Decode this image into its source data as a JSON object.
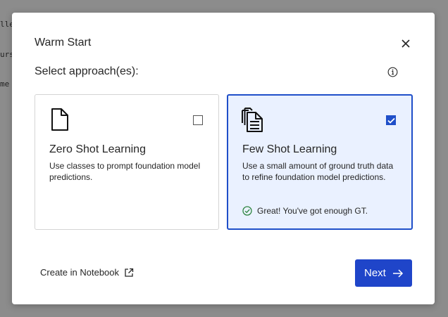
{
  "background": {
    "fragments": [
      "lle",
      "urs",
      " me"
    ]
  },
  "modal": {
    "title": "Warm Start",
    "subtitle": "Select approach(es):",
    "close_icon": "close-icon",
    "info_icon": "info-icon"
  },
  "cards": [
    {
      "title": "Zero Shot Learning",
      "description": "Use classes to prompt foundation model predictions.",
      "icon": "document-icon",
      "checked": false
    },
    {
      "title": "Few Shot Learning",
      "description": "Use a small amount of ground truth data to refine foundation model predictions.",
      "icon": "documents-stack-icon",
      "checked": true,
      "status": "Great! You've got enough GT.",
      "status_icon": "check-circle-icon"
    }
  ],
  "footer": {
    "notebook_link": "Create in Notebook",
    "notebook_icon": "external-link-icon",
    "next_label": "Next",
    "next_icon": "arrow-right-icon"
  },
  "colors": {
    "accent": "#1f45c9",
    "selected_border": "#1f4fc9",
    "selected_bg": "#eaf1ff",
    "success": "#2e8540",
    "overlay": "#8c8c8c"
  }
}
